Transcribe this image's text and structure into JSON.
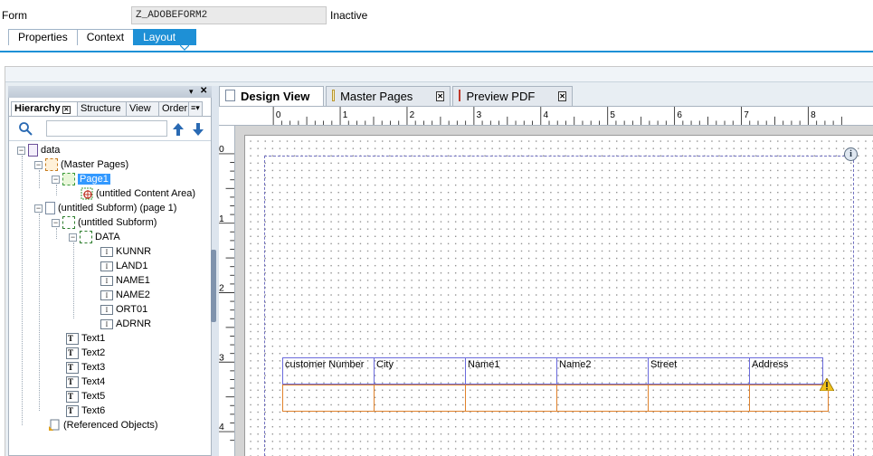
{
  "header": {
    "form_label": "Form",
    "form_name": "Z_ADOBEFORM2",
    "status": "Inactive"
  },
  "tabs": [
    {
      "label": "Properties",
      "active": false
    },
    {
      "label": "Context",
      "active": false
    },
    {
      "label": "Layout",
      "active": true
    }
  ],
  "left_panel": {
    "tabs": [
      "Hierarchy",
      "Structure",
      "View",
      "Order"
    ],
    "tree": [
      {
        "label": "data",
        "level": 0,
        "toggle": "−",
        "icon": "form-icon"
      },
      {
        "label": "(Master Pages)",
        "level": 1,
        "toggle": "−",
        "icon": "master-pages-icon"
      },
      {
        "label": "Page1",
        "level": 2,
        "toggle": "−",
        "icon": "page-icon",
        "selected": true
      },
      {
        "label": "(untitled Content Area)",
        "level": 3,
        "toggle": "",
        "icon": "content-area-icon"
      },
      {
        "label": "(untitled Subform) (page 1)",
        "level": 1,
        "toggle": "−",
        "icon": "subform-page-icon"
      },
      {
        "label": "(untitled Subform)",
        "level": 2,
        "toggle": "−",
        "icon": "subform-icon"
      },
      {
        "label": "DATA",
        "level": 3,
        "toggle": "−",
        "icon": "subform-icon"
      },
      {
        "label": "KUNNR",
        "level": 4,
        "toggle": "",
        "icon": "field-icon"
      },
      {
        "label": "LAND1",
        "level": 4,
        "toggle": "",
        "icon": "field-icon"
      },
      {
        "label": "NAME1",
        "level": 4,
        "toggle": "",
        "icon": "field-icon"
      },
      {
        "label": "NAME2",
        "level": 4,
        "toggle": "",
        "icon": "field-icon"
      },
      {
        "label": "ORT01",
        "level": 4,
        "toggle": "",
        "icon": "field-icon"
      },
      {
        "label": "ADRNR",
        "level": 4,
        "toggle": "",
        "icon": "field-icon"
      },
      {
        "label": "Text1",
        "level": 2,
        "toggle": "",
        "icon": "text-icon"
      },
      {
        "label": "Text2",
        "level": 2,
        "toggle": "",
        "icon": "text-icon"
      },
      {
        "label": "Text3",
        "level": 2,
        "toggle": "",
        "icon": "text-icon"
      },
      {
        "label": "Text4",
        "level": 2,
        "toggle": "",
        "icon": "text-icon"
      },
      {
        "label": "Text5",
        "level": 2,
        "toggle": "",
        "icon": "text-icon"
      },
      {
        "label": "Text6",
        "level": 2,
        "toggle": "",
        "icon": "text-icon"
      },
      {
        "label": "(Referenced Objects)",
        "level": 1,
        "toggle": "",
        "icon": "referenced-objects-icon"
      }
    ]
  },
  "doc_tabs": [
    {
      "label": "Design View",
      "active": true
    },
    {
      "label": "Master Pages",
      "active": false
    },
    {
      "label": "Preview PDF",
      "active": false
    }
  ],
  "ruler": {
    "h_labels": [
      "0",
      "1",
      "2",
      "3",
      "4",
      "5",
      "6",
      "7",
      "8"
    ],
    "v_labels": [
      "0",
      "1",
      "2",
      "3",
      "4"
    ]
  },
  "table": {
    "headers": [
      "customer Number",
      "City",
      "Name1",
      "Name2",
      "Street",
      "Address"
    ]
  },
  "colors": {
    "accent": "#1e90d6",
    "selected": "#3399ff",
    "header_border": "#6a6adc",
    "cell_border": "#e0822c"
  }
}
